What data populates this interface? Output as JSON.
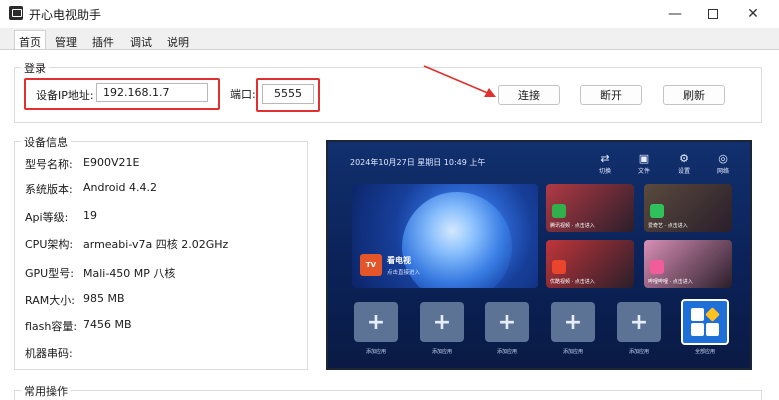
{
  "window": {
    "title": "开心电视助手",
    "minimize_glyph": "—",
    "close_glyph": "✕"
  },
  "tabs": [
    "首页",
    "管理",
    "插件",
    "调试",
    "说明"
  ],
  "login": {
    "group_title": "登录",
    "ip_label": "设备IP地址:",
    "ip_value": "192.168.1.7",
    "port_label": "端口:",
    "port_value": "5555",
    "connect_label": "连接",
    "disconnect_label": "断开",
    "refresh_label": "刷新"
  },
  "device_info": {
    "group_title": "设备信息",
    "rows": [
      {
        "label": "型号名称:",
        "value": "E900V21E"
      },
      {
        "label": "系统版本:",
        "value": "Android 4.4.2"
      },
      {
        "label": "Api等级:",
        "value": "19"
      },
      {
        "label": "CPU架构:",
        "value": "armeabi-v7a 四核 2.02GHz"
      },
      {
        "label": "GPU型号:",
        "value": "Mali-450 MP 八核"
      },
      {
        "label": "RAM大小:",
        "value": "985 MB"
      },
      {
        "label": "flash容量:",
        "value": "7456 MB"
      },
      {
        "label": "机器串码:",
        "value": ""
      }
    ]
  },
  "common_ops": {
    "group_title": "常用操作"
  },
  "tv_screen": {
    "datetime": "2024年10月27日 星期日 10:49 上午",
    "top_items": [
      {
        "icon": "swap-icon",
        "glyph": "⇄",
        "label": "切换"
      },
      {
        "icon": "folder-icon",
        "glyph": "▣",
        "label": "文件"
      },
      {
        "icon": "settings-icon",
        "glyph": "⚙",
        "label": "设置"
      },
      {
        "icon": "network-icon",
        "glyph": "◎",
        "label": "网络"
      }
    ],
    "banner_app_icon": "TV",
    "banner_app_name": "看电视",
    "banner_app_sub": "点击直接进入",
    "tiles": [
      {
        "caption": "腾讯视频  ·  点击进入",
        "color": "#b23a44",
        "icon_color": "#2fb04a"
      },
      {
        "caption": "爱奇艺  ·  点击进入",
        "color": "#5a4a3e",
        "icon_color": "#2fc25a"
      },
      {
        "caption": "优酷视频  ·  点击进入",
        "color": "#c0353a",
        "icon_color": "#e8452c"
      },
      {
        "caption": "哔哩哔哩  ·  点击进入",
        "color": "#d98fb6",
        "icon_color": "#f25c9a"
      }
    ],
    "add_label": "+",
    "add_caption": "添加应用",
    "all_apps_caption": "全部应用"
  },
  "colors": {
    "highlight_red": "#e03030",
    "tv_background": "#0a1e55"
  }
}
